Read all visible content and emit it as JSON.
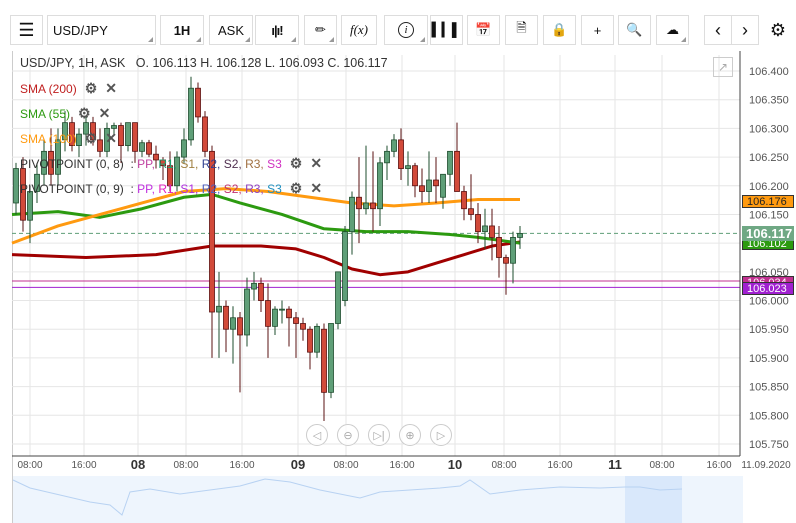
{
  "toolbar": {
    "symbol": "USD/JPY",
    "timeframe": "1H",
    "price_side": "ASK",
    "icons": [
      "menu-icon",
      "candlestick-type-icon",
      "draw-icon",
      "function-icon",
      "info-icon",
      "volume-bars-icon",
      "calendar-icon",
      "news-icon",
      "lock-icon",
      "crosshair-icon",
      "zoom-search-icon",
      "upload-cloud-icon",
      "chevron-left-icon",
      "chevron-right-icon",
      "gear-icon"
    ],
    "fx_label": "f(x)"
  },
  "legend": {
    "title": "USD/JPY, 1H, ASK",
    "ohlc": "O. 106.113 H. 106.128 L. 106.093 C. 106.117",
    "sma200": "SMA (200)",
    "sma55": "SMA (55)",
    "sma100": "SMA (100)",
    "pivot8": {
      "name": "PIVOTPOINT (0, 8)",
      "sep": ":",
      "levels": [
        {
          "t": "PP",
          "c": "#c040a0"
        },
        {
          "t": "R1",
          "c": "#20a070"
        },
        {
          "t": "S1",
          "c": "#a08040"
        },
        {
          "t": "R2",
          "c": "#304090"
        },
        {
          "t": "S2",
          "c": "#503050"
        },
        {
          "t": "R3",
          "c": "#a07040"
        },
        {
          "t": "S3",
          "c": "#d030c0"
        }
      ]
    },
    "pivot9": {
      "name": "PIVOTPOINT (0, 9)",
      "sep": ":",
      "levels": [
        {
          "t": "PP",
          "c": "#c030e0"
        },
        {
          "t": "R1",
          "c": "#e020c0"
        },
        {
          "t": "S1",
          "c": "#b030e0"
        },
        {
          "t": "R2",
          "c": "#5060c0"
        },
        {
          "t": "S2",
          "c": "#c03070"
        },
        {
          "t": "R3",
          "c": "#9040c0"
        },
        {
          "t": "S3",
          "c": "#2090c0"
        }
      ]
    }
  },
  "colors": {
    "up": "#5f9f78",
    "down": "#d24a3a",
    "sma200": "#a00000",
    "sma55": "#2c9a10",
    "sma100": "#ff9a10",
    "pivot8": "#c03090",
    "pivot9": "#a020d0",
    "current": "#5f9f78"
  },
  "price_axis": {
    "ticks": [
      "106.400",
      "106.350",
      "106.300",
      "106.250",
      "106.200",
      "106.150",
      "106.100",
      "106.050",
      "106.000",
      "105.950",
      "105.900",
      "105.850",
      "105.800",
      "105.750"
    ],
    "max": 106.4,
    "min": 105.75
  },
  "price_tags": {
    "sma100": "106.176",
    "current": "106.117",
    "sma55": "106.102",
    "pivot8": "106.034",
    "pivot9": "106.023"
  },
  "time_axis": [
    {
      "t": "08:00",
      "b": false
    },
    {
      "t": "16:00",
      "b": false
    },
    {
      "t": "08",
      "b": true
    },
    {
      "t": "08:00",
      "b": false
    },
    {
      "t": "16:00",
      "b": false
    },
    {
      "t": "09",
      "b": true
    },
    {
      "t": "08:00",
      "b": false
    },
    {
      "t": "16:00",
      "b": false
    },
    {
      "t": "10",
      "b": true
    },
    {
      "t": "08:00",
      "b": false
    },
    {
      "t": "16:00",
      "b": false
    },
    {
      "t": "11",
      "b": true
    },
    {
      "t": "08:00",
      "b": false
    },
    {
      "t": "16:00",
      "b": false
    },
    {
      "t": "11.09.2020",
      "b": false
    }
  ],
  "chart_data": {
    "type": "candlestick",
    "symbol": "USD/JPY",
    "interval": "1H",
    "candles": [
      [
        106.17,
        106.24,
        106.15,
        106.23
      ],
      [
        106.23,
        106.25,
        106.12,
        106.14
      ],
      [
        106.14,
        106.2,
        106.1,
        106.19
      ],
      [
        106.19,
        106.24,
        106.17,
        106.22
      ],
      [
        106.22,
        106.28,
        106.2,
        106.26
      ],
      [
        106.26,
        106.3,
        106.2,
        106.22
      ],
      [
        106.22,
        106.3,
        106.2,
        106.28
      ],
      [
        106.28,
        106.33,
        106.26,
        106.31
      ],
      [
        106.31,
        106.32,
        106.26,
        106.27
      ],
      [
        106.27,
        106.3,
        106.25,
        106.29
      ],
      [
        106.29,
        106.32,
        106.27,
        106.31
      ],
      [
        106.31,
        106.32,
        106.27,
        106.28
      ],
      [
        106.28,
        106.3,
        106.25,
        106.26
      ],
      [
        106.26,
        106.31,
        106.25,
        106.3
      ],
      [
        106.3,
        106.31,
        106.29,
        106.305
      ],
      [
        106.305,
        106.31,
        106.24,
        106.27
      ],
      [
        106.27,
        106.31,
        106.26,
        106.31
      ],
      [
        106.31,
        106.31,
        106.24,
        106.26
      ],
      [
        106.26,
        106.28,
        106.25,
        106.275
      ],
      [
        106.275,
        106.28,
        106.25,
        106.255
      ],
      [
        106.255,
        106.27,
        106.23,
        106.245
      ],
      [
        106.245,
        106.25,
        106.21,
        106.235
      ],
      [
        106.235,
        106.26,
        106.19,
        106.2
      ],
      [
        106.2,
        106.26,
        106.19,
        106.25
      ],
      [
        106.25,
        106.3,
        106.24,
        106.28
      ],
      [
        106.28,
        106.39,
        106.27,
        106.37
      ],
      [
        106.37,
        106.38,
        106.31,
        106.32
      ],
      [
        106.32,
        106.33,
        106.25,
        106.26
      ],
      [
        106.26,
        106.27,
        105.9,
        105.98
      ],
      [
        105.98,
        106.05,
        105.9,
        105.99
      ],
      [
        105.99,
        106.0,
        105.91,
        105.95
      ],
      [
        105.95,
        105.99,
        105.89,
        105.97
      ],
      [
        105.97,
        105.98,
        105.84,
        105.94
      ],
      [
        105.94,
        106.04,
        105.92,
        106.02
      ],
      [
        106.02,
        106.05,
        106.0,
        106.03
      ],
      [
        106.03,
        106.04,
        105.98,
        106.0
      ],
      [
        106.0,
        106.03,
        105.9,
        105.955
      ],
      [
        105.955,
        105.99,
        105.94,
        105.985
      ],
      [
        105.985,
        106.0,
        105.96,
        105.985
      ],
      [
        105.985,
        105.99,
        105.92,
        105.97
      ],
      [
        105.97,
        105.98,
        105.9,
        105.96
      ],
      [
        105.96,
        105.97,
        105.93,
        105.95
      ],
      [
        105.95,
        105.955,
        105.88,
        105.91
      ],
      [
        105.91,
        105.96,
        105.9,
        105.955
      ],
      [
        105.95,
        105.96,
        105.79,
        105.84
      ],
      [
        105.84,
        105.96,
        105.83,
        105.96
      ],
      [
        105.96,
        106.05,
        105.95,
        106.05
      ],
      [
        106.0,
        106.13,
        105.99,
        106.12
      ],
      [
        106.12,
        106.19,
        106.08,
        106.18
      ],
      [
        106.18,
        106.25,
        106.1,
        106.16
      ],
      [
        106.16,
        106.27,
        106.15,
        106.17
      ],
      [
        106.17,
        106.26,
        106.12,
        106.16
      ],
      [
        106.16,
        106.25,
        106.13,
        106.24
      ],
      [
        106.24,
        106.27,
        106.21,
        106.26
      ],
      [
        106.26,
        106.29,
        106.25,
        106.28
      ],
      [
        106.28,
        106.3,
        106.21,
        106.23
      ],
      [
        106.23,
        106.26,
        106.2,
        106.235
      ],
      [
        106.235,
        106.24,
        106.18,
        106.2
      ],
      [
        106.2,
        106.23,
        106.17,
        106.19
      ],
      [
        106.19,
        106.26,
        106.17,
        106.21
      ],
      [
        106.21,
        106.25,
        106.17,
        106.2
      ],
      [
        106.18,
        106.22,
        106.16,
        106.22
      ],
      [
        106.22,
        106.26,
        106.2,
        106.26
      ],
      [
        106.26,
        106.31,
        106.2,
        106.19
      ],
      [
        106.19,
        106.2,
        106.14,
        106.16
      ],
      [
        106.16,
        106.22,
        106.14,
        106.15
      ],
      [
        106.15,
        106.17,
        106.1,
        106.12
      ],
      [
        106.12,
        106.16,
        106.09,
        106.13
      ],
      [
        106.13,
        106.16,
        106.07,
        106.11
      ],
      [
        106.11,
        106.13,
        106.04,
        106.075
      ],
      [
        106.075,
        106.08,
        106.01,
        106.065
      ],
      [
        106.065,
        106.12,
        106.03,
        106.11
      ],
      [
        106.11,
        106.13,
        106.09,
        106.117
      ]
    ],
    "sma200": [
      [
        -1,
        106.08
      ],
      [
        10,
        106.075
      ],
      [
        20,
        106.08
      ],
      [
        28,
        106.095
      ],
      [
        35,
        106.095
      ],
      [
        40,
        106.09
      ],
      [
        44,
        106.075
      ],
      [
        48,
        106.055
      ],
      [
        52,
        106.045
      ],
      [
        56,
        106.05
      ],
      [
        60,
        106.065
      ],
      [
        64,
        106.08
      ],
      [
        68,
        106.095
      ],
      [
        72,
        106.102
      ]
    ],
    "sma55": [
      [
        -1,
        106.15
      ],
      [
        6,
        106.155
      ],
      [
        12,
        106.145
      ],
      [
        18,
        106.16
      ],
      [
        24,
        106.18
      ],
      [
        28,
        106.185
      ],
      [
        32,
        106.17
      ],
      [
        38,
        106.15
      ],
      [
        44,
        106.125
      ],
      [
        50,
        106.12
      ],
      [
        56,
        106.12
      ],
      [
        62,
        106.115
      ],
      [
        66,
        106.11
      ],
      [
        72,
        106.1
      ]
    ],
    "sma100": [
      [
        -1,
        106.1
      ],
      [
        6,
        106.13
      ],
      [
        12,
        106.15
      ],
      [
        18,
        106.17
      ],
      [
        24,
        106.19
      ],
      [
        30,
        106.195
      ],
      [
        36,
        106.19
      ],
      [
        42,
        106.18
      ],
      [
        48,
        106.17
      ],
      [
        54,
        106.165
      ],
      [
        60,
        106.17
      ],
      [
        66,
        106.176
      ],
      [
        72,
        106.176
      ]
    ],
    "pivot8": 106.034,
    "pivot9": 106.023,
    "current": 106.117
  }
}
